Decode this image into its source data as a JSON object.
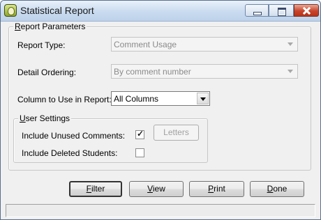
{
  "window": {
    "title": "Statistical Report",
    "controls": {
      "minimize": "minimize",
      "maximize": "maximize",
      "close": "close"
    }
  },
  "report_parameters": {
    "group_label_accel": "R",
    "group_label_rest": "eport Parameters",
    "report_type": {
      "label": "Report Type:",
      "value": "Comment Usage",
      "enabled": false
    },
    "detail_ordering": {
      "label": "Detail Ordering:",
      "value": "By comment number",
      "enabled": false
    },
    "column_to_use": {
      "label": "Column to Use in Report:",
      "value": "All Columns",
      "enabled": true
    }
  },
  "user_settings": {
    "group_label_accel": "U",
    "group_label_rest": "ser Settings",
    "include_unused": {
      "label": "Include Unused Comments:",
      "checked": true,
      "mark": "✓"
    },
    "include_deleted": {
      "label": "Include Deleted Students:",
      "checked": false
    },
    "letters_button": "Letters"
  },
  "buttons": {
    "filter": {
      "accel": "F",
      "rest": "ilter"
    },
    "view": {
      "accel": "V",
      "rest": "iew"
    },
    "print": {
      "accel": "P",
      "rest": "rint"
    },
    "done": {
      "accel": "D",
      "rest": "one"
    }
  },
  "status": {
    "text": ""
  }
}
